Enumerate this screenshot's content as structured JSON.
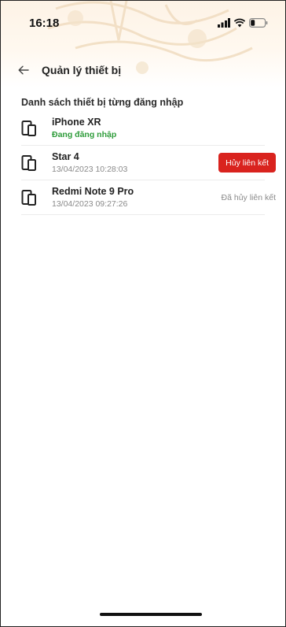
{
  "status_bar": {
    "time": "16:18",
    "icons": [
      "signal-icon",
      "wifi-icon",
      "battery-icon"
    ]
  },
  "nav": {
    "back_icon": "arrow-left-icon",
    "title": "Quản lý thiết bị"
  },
  "section": {
    "title": "Danh sách thiết bị từng đăng nhập"
  },
  "devices": [
    {
      "name": "iPhone XR",
      "subtitle": "Đang đăng nhập",
      "status": "current",
      "icon": "devices-icon"
    },
    {
      "name": "Star 4",
      "subtitle": "13/04/2023 10:28:03",
      "status": "linked",
      "action_label": "Hủy liên kết",
      "icon": "devices-icon"
    },
    {
      "name": "Redmi Note 9 Pro",
      "subtitle": "13/04/2023 09:27:26",
      "status": "unlinked",
      "status_label": "Đã hủy liên kết",
      "icon": "devices-icon"
    }
  ],
  "colors": {
    "accent_red": "#d9231e",
    "active_green": "#2e9c3a",
    "header_tint": "#fdf3e6"
  }
}
